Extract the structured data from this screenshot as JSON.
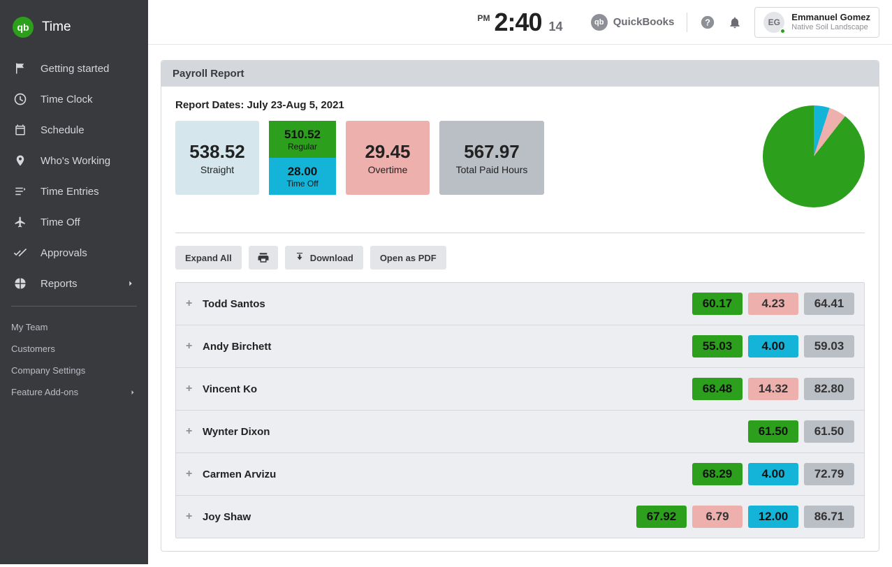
{
  "brand": {
    "name": "Time",
    "logo_text": "qb"
  },
  "sidebar": {
    "items": [
      {
        "label": "Getting started"
      },
      {
        "label": "Time Clock"
      },
      {
        "label": "Schedule"
      },
      {
        "label": "Who's Working"
      },
      {
        "label": "Time Entries"
      },
      {
        "label": "Time Off"
      },
      {
        "label": "Approvals"
      },
      {
        "label": "Reports"
      }
    ],
    "secondary": [
      {
        "label": "My Team"
      },
      {
        "label": "Customers"
      },
      {
        "label": "Company Settings"
      },
      {
        "label": "Feature Add-ons"
      }
    ]
  },
  "topbar": {
    "clock": {
      "ampm": "PM",
      "time": "2:40",
      "seconds": "14"
    },
    "quickbooks_label": "QuickBooks",
    "user": {
      "initials": "EG",
      "name": "Emmanuel Gomez",
      "org": "Native Soil Landscape"
    }
  },
  "report": {
    "panel_title": "Payroll Report",
    "dates_label": "Report Dates:",
    "dates_value": "July 23-Aug 5, 2021",
    "summary": {
      "straight": {
        "value": "538.52",
        "label": "Straight"
      },
      "regular": {
        "value": "510.52",
        "label": "Regular"
      },
      "timeoff": {
        "value": "28.00",
        "label": "Time Off"
      },
      "overtime": {
        "value": "29.45",
        "label": "Overtime"
      },
      "total": {
        "value": "567.97",
        "label": "Total Paid Hours"
      }
    },
    "actions": {
      "expand_all": "Expand All",
      "download": "Download",
      "open_pdf": "Open as PDF"
    },
    "rows": [
      {
        "name": "Todd Santos",
        "green": "60.17",
        "pink": "4.23",
        "cyan": null,
        "cyan2": null,
        "gray": "64.41"
      },
      {
        "name": "Andy Birchett",
        "green": "55.03",
        "pink": null,
        "cyan": "4.00",
        "cyan2": null,
        "gray": "59.03"
      },
      {
        "name": "Vincent Ko",
        "green": "68.48",
        "pink": "14.32",
        "cyan": null,
        "cyan2": null,
        "gray": "82.80"
      },
      {
        "name": "Wynter Dixon",
        "green": "61.50",
        "pink": null,
        "cyan": null,
        "cyan2": null,
        "gray": "61.50"
      },
      {
        "name": "Carmen Arvizu",
        "green": "68.29",
        "pink": null,
        "cyan": "4.00",
        "cyan2": null,
        "gray": "72.79"
      },
      {
        "name": "Joy Shaw",
        "green": "67.92",
        "pink": "6.79",
        "cyan": null,
        "cyan2": "12.00",
        "gray": "86.71"
      }
    ]
  },
  "chart_data": {
    "type": "pie",
    "title": "",
    "series": [
      {
        "name": "Regular",
        "value": 510.52,
        "color": "#2ca01c"
      },
      {
        "name": "Overtime",
        "value": 29.45,
        "color": "#eeb0ad"
      },
      {
        "name": "Time Off",
        "value": 28.0,
        "color": "#14b4d8"
      }
    ]
  }
}
